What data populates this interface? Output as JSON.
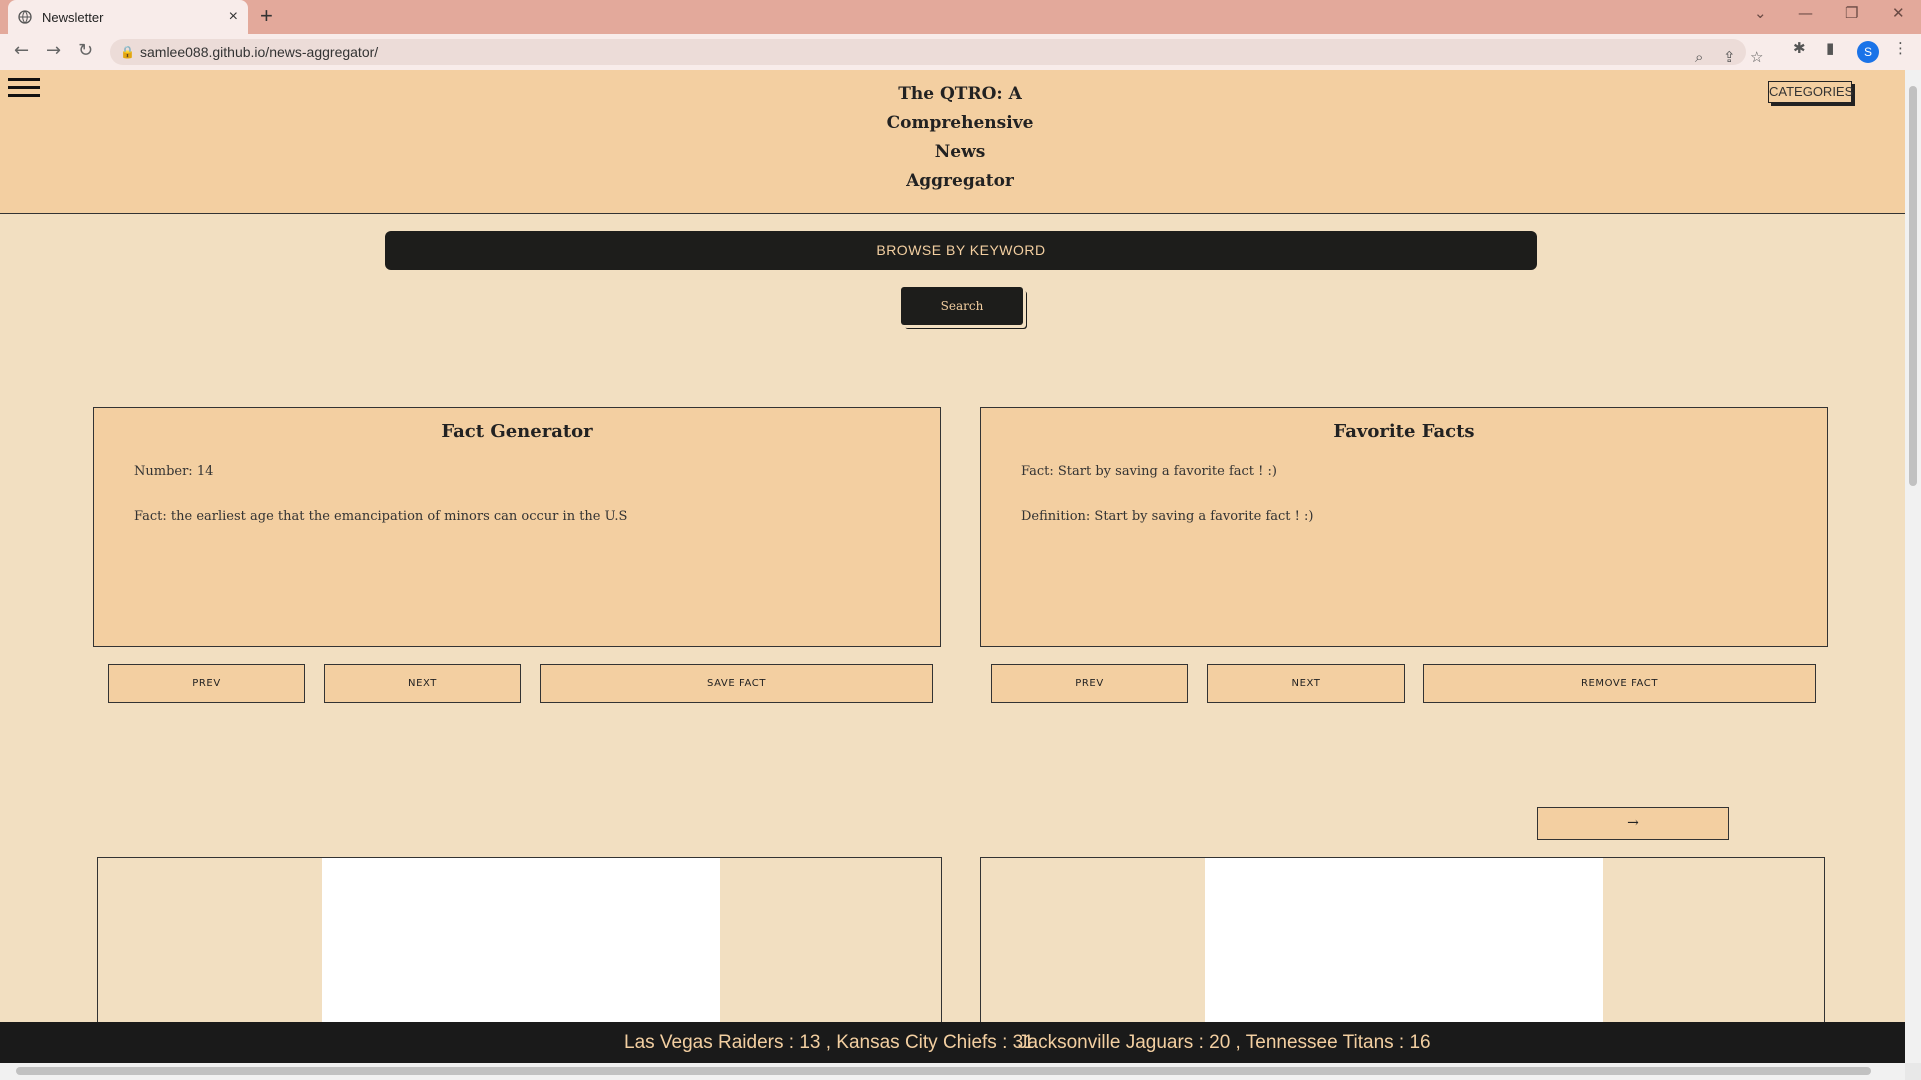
{
  "browser": {
    "tab_title": "Newsletter",
    "tab_close": "×",
    "new_tab": "+",
    "url": "samlee088.github.io/news-aggregator/",
    "avatar_letter": "S"
  },
  "header": {
    "title_lines": [
      "The QTRO: A",
      "Comprehensive",
      "News",
      "Aggregator"
    ],
    "categories_label": "CATEGORIES"
  },
  "search": {
    "browse_label": "BROWSE BY KEYWORD",
    "search_button": "Search"
  },
  "fact_generator": {
    "heading": "Fact Generator",
    "number_line": "Number: 14",
    "fact_line": "Fact: the earliest age that the emancipation of minors can occur in the U.S",
    "prev_label": "PREV",
    "next_label": "NEXT",
    "save_label": "SAVE FACT"
  },
  "favorite_facts": {
    "heading": "Favorite Facts",
    "fact_line": "Fact: Start by saving a favorite fact ! :)",
    "definition_line": "Definition: Start by saving a favorite fact ! :)",
    "prev_label": "PREV",
    "next_label": "NEXT",
    "remove_label": "REMOVE FACT"
  },
  "arrow_button": "→",
  "ticker": {
    "items": [
      "Las Vegas Raiders : 13 , Kansas City Chiefs : 31",
      "Jacksonville Jaguars : 20 , Tennessee Titans : 16"
    ]
  },
  "colors": {
    "page_bg": "#f2dfc1",
    "header_bg": "#f3cfa1",
    "dark": "#1d1d1b",
    "chrome": "#e3a99b"
  }
}
